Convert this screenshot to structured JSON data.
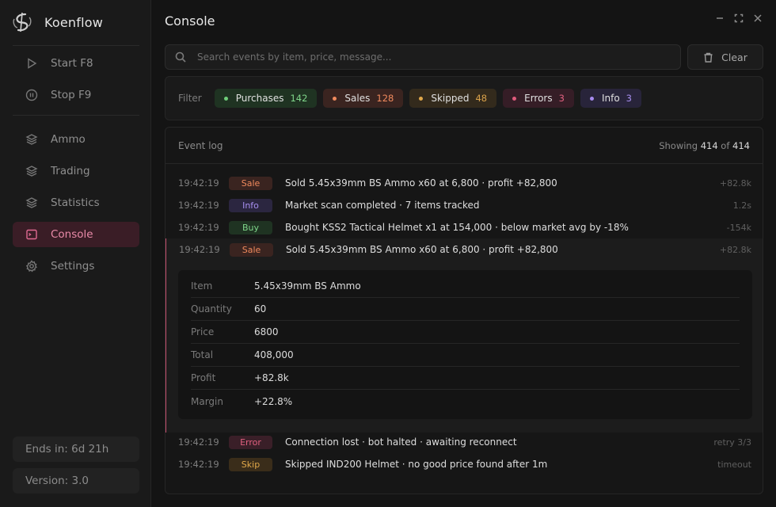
{
  "app": {
    "name": "Koenflow"
  },
  "sidebar": {
    "controls": [
      {
        "label": "Start F8",
        "icon": "play-icon"
      },
      {
        "label": "Stop F9",
        "icon": "pause-icon"
      }
    ],
    "items": [
      {
        "label": "Ammo",
        "icon": "layers-icon"
      },
      {
        "label": "Trading",
        "icon": "layers-icon"
      },
      {
        "label": "Statistics",
        "icon": "layers-icon"
      },
      {
        "label": "Console",
        "icon": "terminal-icon",
        "active": true
      },
      {
        "label": "Settings",
        "icon": "gear-icon"
      }
    ],
    "ends_in": "Ends in: 6d 21h",
    "version": "Version: 3.0"
  },
  "page": {
    "title": "Console"
  },
  "search": {
    "placeholder": "Search events by item, price, message..."
  },
  "clear_label": "Clear",
  "filter": {
    "label": "Filter",
    "chips": [
      {
        "label": "Purchases",
        "count": "142",
        "bg": "#1f3322",
        "dot": "#6fcf7a",
        "count_color": "#7fd58a"
      },
      {
        "label": "Sales",
        "count": "128",
        "bg": "#3a2420",
        "dot": "#f08a5d",
        "count_color": "#f08a5d"
      },
      {
        "label": "Skipped",
        "count": "48",
        "bg": "#332a1c",
        "dot": "#e0a84a",
        "count_color": "#d9a24a"
      },
      {
        "label": "Errors",
        "count": "3",
        "bg": "#351d26",
        "dot": "#e05a7c",
        "count_color": "#e0607f"
      },
      {
        "label": "Info",
        "count": "3",
        "bg": "#28243a",
        "dot": "#a78bf0",
        "count_color": "#a88ff0"
      }
    ]
  },
  "log": {
    "title": "Event log",
    "showing_prefix": "Showing",
    "showing_count": "414",
    "showing_of": "of",
    "showing_total": "414",
    "rows": [
      {
        "time": "19:42:19",
        "type": "Sale",
        "message": "Sold 5.45x39mm BS Ammo x60 at 6,800 · profit +82,800",
        "right": "+82.8k"
      },
      {
        "time": "19:42:19",
        "type": "Info",
        "message": "Market scan completed · 7 items tracked",
        "right": "1.2s"
      },
      {
        "time": "19:42:19",
        "type": "Buy",
        "message": "Bought KSS2 Tactical Helmet x1 at 154,000 · below market  avg by -18%",
        "right": "-154k"
      },
      {
        "time": "19:42:19",
        "type": "Sale",
        "message": "Sold 5.45x39mm BS Ammo x60 at 6,800 · profit +82,800",
        "right": "+82.8k"
      },
      {
        "time": "19:42:19",
        "type": "Error",
        "message": "Connection lost · bot halted · awaiting reconnect",
        "right": "retry 3/3"
      },
      {
        "time": "19:42:19",
        "type": "Skip",
        "message": "Skipped IND200 Helmet · no good price found after 1m",
        "right": "timeout"
      }
    ],
    "detail": [
      {
        "key": "Item",
        "value": "5.45x39mm BS Ammo"
      },
      {
        "key": "Quantity",
        "value": "60"
      },
      {
        "key": "Price",
        "value": "6800"
      },
      {
        "key": "Total",
        "value": "408,000"
      },
      {
        "key": "Profit",
        "value": "+82.8k"
      },
      {
        "key": "Margin",
        "value": "+22.8%"
      }
    ]
  },
  "badge_colors": {
    "Sale": {
      "bg": "#3a2420",
      "fg": "#f08a5d"
    },
    "Info": {
      "bg": "#2b2640",
      "fg": "#a88ff0"
    },
    "Buy": {
      "bg": "#1f3322",
      "fg": "#7fd58a"
    },
    "Error": {
      "bg": "#3a1f28",
      "fg": "#e0607f"
    },
    "Skip": {
      "bg": "#3a2d1a",
      "fg": "#e0a84a"
    }
  }
}
